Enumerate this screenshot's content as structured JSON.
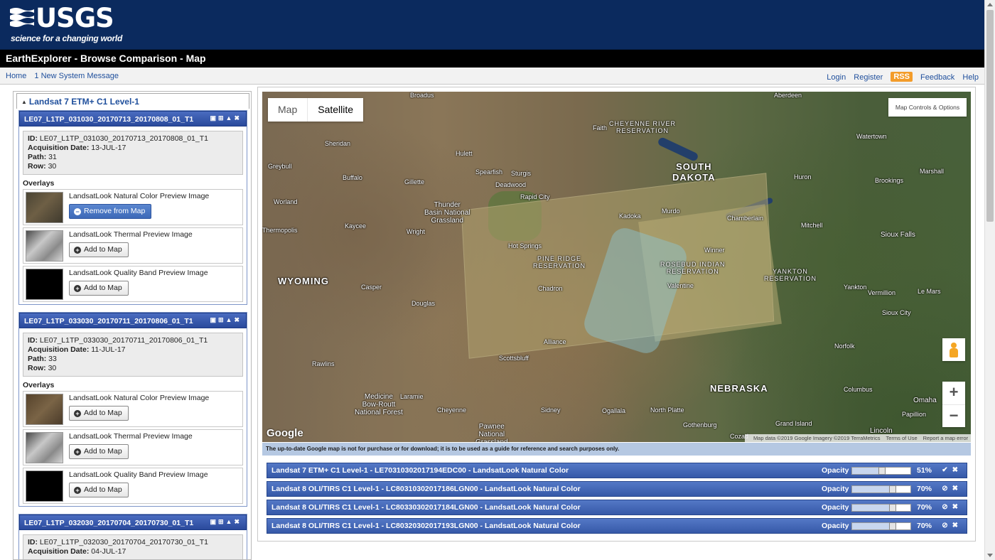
{
  "header": {
    "logo_text": "USGS",
    "logo_tagline": "science for a changing world",
    "title": "EarthExplorer - Browse Comparison - Map"
  },
  "nav": {
    "left": [
      "Home",
      "1 New System Message"
    ],
    "right": [
      "Login",
      "Register",
      "RSS",
      "Feedback",
      "Help"
    ]
  },
  "collection": {
    "title": "Landsat 7 ETM+ C1 Level-1"
  },
  "scenes": [
    {
      "name": "LE07_L1TP_031030_20170713_20170808_01_T1",
      "id_label": "ID:",
      "id": "LE07_L1TP_031030_20170713_20170808_01_T1",
      "date_label": "Acquisition Date:",
      "date": "13-JUL-17",
      "path_label": "Path:",
      "path": "31",
      "row_label": "Row:",
      "row": "30",
      "overlays_label": "Overlays",
      "overlays": [
        {
          "title": "LandsatLook Natural Color Preview Image",
          "button": "Remove from Map",
          "active": true,
          "icon": "minus-circle-icon"
        },
        {
          "title": "LandsatLook Thermal Preview Image",
          "button": "Add to Map",
          "active": false,
          "icon": "plus-circle-icon"
        },
        {
          "title": "LandsatLook Quality Band Preview Image",
          "button": "Add to Map",
          "active": false,
          "icon": "plus-circle-icon"
        }
      ]
    },
    {
      "name": "LE07_L1TP_033030_20170711_20170806_01_T1",
      "id_label": "ID:",
      "id": "LE07_L1TP_033030_20170711_20170806_01_T1",
      "date_label": "Acquisition Date:",
      "date": "11-JUL-17",
      "path_label": "Path:",
      "path": "33",
      "row_label": "Row:",
      "row": "30",
      "overlays_label": "Overlays",
      "overlays": [
        {
          "title": "LandsatLook Natural Color Preview Image",
          "button": "Add to Map",
          "active": false,
          "icon": "plus-circle-icon"
        },
        {
          "title": "LandsatLook Thermal Preview Image",
          "button": "Add to Map",
          "active": false,
          "icon": "plus-circle-icon"
        },
        {
          "title": "LandsatLook Quality Band Preview Image",
          "button": "Add to Map",
          "active": false,
          "icon": "plus-circle-icon"
        }
      ]
    },
    {
      "name": "LE07_L1TP_032030_20170704_20170730_01_T1",
      "id_label": "ID:",
      "id": "LE07_L1TP_032030_20170704_20170730_01_T1",
      "date_label": "Acquisition Date:",
      "date": "04-JUL-17"
    }
  ],
  "map": {
    "type_tabs": [
      "Map",
      "Satellite"
    ],
    "selected_type": "Satellite",
    "controls_button": "Map Controls & Options",
    "zoom_in": "+",
    "zoom_out": "−",
    "google_logo": "Google",
    "attribution": [
      "Map data ©2019 Google Imagery ©2019 TerraMetrics",
      "Terms of Use",
      "Report a map error"
    ],
    "labels": {
      "south_dakota": "SOUTH\nDAKOTA",
      "wyoming": "WYOMING",
      "nebraska": "NEBRASKA",
      "cheyenne_river": "CHEYENNE RIVER\nRESERVATION",
      "yankton": "YANKTON\nRESERVATION",
      "pine_ridge": "PINE RIDGE\nRESERVATION",
      "rosebud": "ROSEBUD INDIAN\nRESERVATION",
      "thunder_basin": "Thunder\nBasin National\nGrassland",
      "medicine_bow": "Medicine\nBow-Routt\nNational Forest",
      "pawnee": "Pawnee\nNational\nGrassland",
      "sheridan": "Sheridan",
      "buffalo": "Buffalo",
      "gillette": "Gillette",
      "hulett": "Hulett",
      "spearfish": "Spearfish",
      "sturgis": "Sturgis",
      "deadwood": "Deadwood",
      "rapid_city": "Rapid City",
      "faith": "Faith",
      "watertown": "Watertown",
      "aberdeen": "Aberdeen",
      "huron": "Huron",
      "brookings": "Brookings",
      "marshall": "Marshall",
      "mitchell": "Mitchell",
      "sioux_falls": "Sioux Falls",
      "worland": "Worland",
      "kaycee": "Kaycee",
      "wright": "Wright",
      "casper": "Casper",
      "douglas": "Douglas",
      "alliance": "Alliance",
      "scottsbluff": "Scottsbluff",
      "rawlins": "Rawlins",
      "laramie": "Laramie",
      "cheyenne": "Cheyenne",
      "sidney": "Sidney",
      "ogallala": "Ogallala",
      "north_platte": "North Platte",
      "gothenburg": "Gothenburg",
      "cozad": "Cozad",
      "grand_island": "Grand Island",
      "lincoln": "Lincoln",
      "columbus": "Columbus",
      "omaha": "Omaha",
      "norfolk": "Norfolk",
      "sioux_city": "Sioux City",
      "vermillion": "Vermillion",
      "yankton_city": "Yankton",
      "le_mars": "Le Mars",
      "broadus": "Broadus",
      "hot_springs": "Hot Springs",
      "kadoka": "Kadoka",
      "murdo": "Murdo",
      "chamberlain": "Chamberlain",
      "winner": "Winner",
      "chadron": "Chadron",
      "valentine": "Valentine",
      "greybull": "Greybull",
      "thermopolis": "Thermopolis",
      "papillion": "Papillion"
    }
  },
  "disclaimer": "The up-to-date Google map is not for purchase or for download; it is to be used as a guide for reference and search purposes only.",
  "layers": [
    {
      "name": "Landsat 7 ETM+ C1 Level-1 - LE70310302017194EDC00 - LandsatLook Natural Color",
      "opacity_label": "Opacity",
      "opacity": "51%",
      "opacity_value": 51,
      "status_icon": "check-icon"
    },
    {
      "name": "Landsat 8 OLI/TIRS C1 Level-1 - LC80310302017186LGN00 - LandsatLook Natural Color",
      "opacity_label": "Opacity",
      "opacity": "70%",
      "opacity_value": 70,
      "status_icon": "hidden-icon"
    },
    {
      "name": "Landsat 8 OLI/TIRS C1 Level-1 - LC80330302017184LGN00 - LandsatLook Natural Color",
      "opacity_label": "Opacity",
      "opacity": "70%",
      "opacity_value": 70,
      "status_icon": "hidden-icon"
    },
    {
      "name": "Landsat 8 OLI/TIRS C1 Level-1 - LC80320302017193LGN00 - LandsatLook Natural Color",
      "opacity_label": "Opacity",
      "opacity": "70%",
      "opacity_value": 70,
      "status_icon": "hidden-icon"
    }
  ]
}
